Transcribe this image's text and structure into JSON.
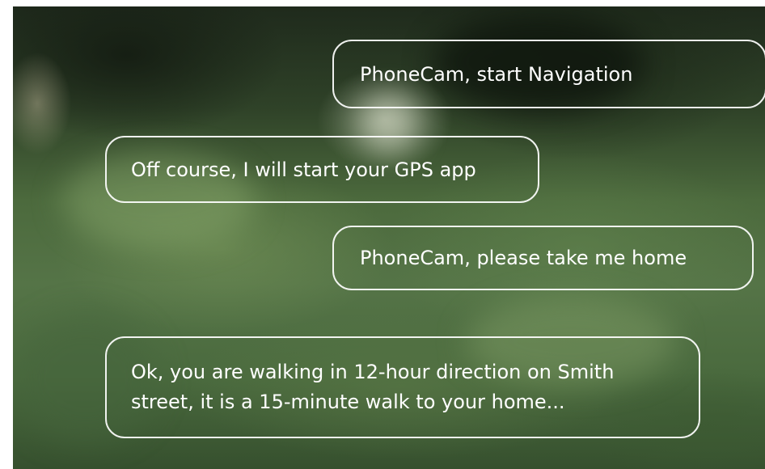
{
  "messages": [
    {
      "role": "user",
      "text": "PhoneCam, start Navigation"
    },
    {
      "role": "assistant",
      "text": "Off course, I will start your GPS app"
    },
    {
      "role": "user",
      "text": "PhoneCam, please take me home"
    },
    {
      "role": "assistant",
      "text": "Ok,  you are walking in 12-hour direction on Smith street, it is a 15-minute walk to your home..."
    }
  ]
}
